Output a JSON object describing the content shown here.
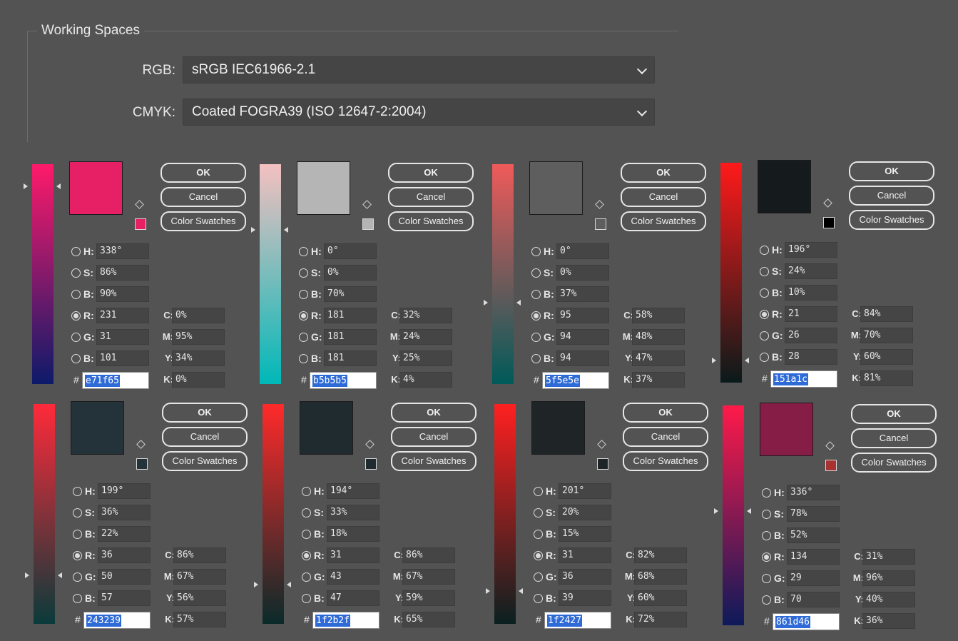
{
  "working_spaces": {
    "title": "Working Spaces",
    "rgb_label": "RGB:",
    "rgb_value": "sRGB IEC61966-2.1",
    "cmyk_label": "CMYK:",
    "cmyk_value": "Coated FOGRA39 (ISO 12647-2:2004)"
  },
  "buttons": {
    "ok": "OK",
    "cancel": "Cancel",
    "swatches": "Color Swatches"
  },
  "labels": {
    "h": "H:",
    "s": "S:",
    "b": "B:",
    "r": "R:",
    "g": "G:",
    "bl": "B:",
    "c": "C:",
    "m": "M:",
    "y": "Y:",
    "k": "K:",
    "hash": "#"
  },
  "pickers": [
    {
      "swatch": "#e71f65",
      "mini": "#e71f65",
      "grad_top": "#ff1a6a",
      "grad_bottom": "#0d1a6a",
      "slider_level": 0.1,
      "h": "338°",
      "s": "86%",
      "b": "90%",
      "r": "231",
      "g": "31",
      "bl": "101",
      "hex": "e71f65",
      "c": "0%",
      "m": "95%",
      "y": "34%",
      "k": "0%"
    },
    {
      "swatch": "#b5b5b5",
      "mini": "#b5b5b5",
      "grad_top": "#f5c0c0",
      "grad_bottom": "#00b8b8",
      "slider_level": 0.3,
      "h": "0°",
      "s": "0%",
      "b": "70%",
      "r": "181",
      "g": "181",
      "bl": "181",
      "hex": "b5b5b5",
      "c": "32%",
      "m": "24%",
      "y": "25%",
      "k": "4%"
    },
    {
      "swatch": "#5f5e5e",
      "mini": "#5f5e5e",
      "grad_top": "#f05a5a",
      "grad_bottom": "#005a5a",
      "slider_level": 0.63,
      "h": "0°",
      "s": "0%",
      "b": "37%",
      "r": "95",
      "g": "94",
      "bl": "94",
      "hex": "5f5e5e",
      "c": "58%",
      "m": "48%",
      "y": "47%",
      "k": "37%"
    },
    {
      "swatch": "#151a1c",
      "mini": "#000000",
      "grad_top": "#ff1a1a",
      "grad_bottom": "#0a1a1a",
      "slider_level": 0.9,
      "h": "196°",
      "s": "24%",
      "b": "10%",
      "r": "21",
      "g": "26",
      "bl": "28",
      "hex": "151a1c",
      "c": "84%",
      "m": "70%",
      "y": "60%",
      "k": "81%"
    },
    {
      "swatch": "#243239",
      "mini": "#243239",
      "grad_top": "#ff2a3a",
      "grad_bottom": "#0a3a3a",
      "slider_level": 0.78,
      "h": "199°",
      "s": "36%",
      "b": "22%",
      "r": "36",
      "g": "50",
      "bl": "57",
      "hex": "243239",
      "c": "86%",
      "m": "67%",
      "y": "56%",
      "k": "57%"
    },
    {
      "swatch": "#1f2b2f",
      "mini": "#1f2b2f",
      "grad_top": "#ff2a2a",
      "grad_bottom": "#0a2a2a",
      "slider_level": 0.82,
      "h": "194°",
      "s": "33%",
      "b": "18%",
      "r": "31",
      "g": "43",
      "bl": "47",
      "hex": "1f2b2f",
      "c": "86%",
      "m": "67%",
      "y": "59%",
      "k": "65%"
    },
    {
      "swatch": "#1f2427",
      "mini": "#1f2427",
      "grad_top": "#ff2020",
      "grad_bottom": "#0a2020",
      "slider_level": 0.85,
      "h": "201°",
      "s": "20%",
      "b": "15%",
      "r": "31",
      "g": "36",
      "bl": "39",
      "hex": "1f2427",
      "c": "82%",
      "m": "68%",
      "y": "60%",
      "k": "72%"
    },
    {
      "swatch": "#861d46",
      "mini": "#a83232",
      "grad_top": "#ff1a4a",
      "grad_bottom": "#0d1a5a",
      "slider_level": 0.48,
      "h": "336°",
      "s": "78%",
      "b": "52%",
      "r": "134",
      "g": "29",
      "bl": "70",
      "hex": "861d46",
      "c": "31%",
      "m": "96%",
      "y": "40%",
      "k": "36%"
    }
  ]
}
